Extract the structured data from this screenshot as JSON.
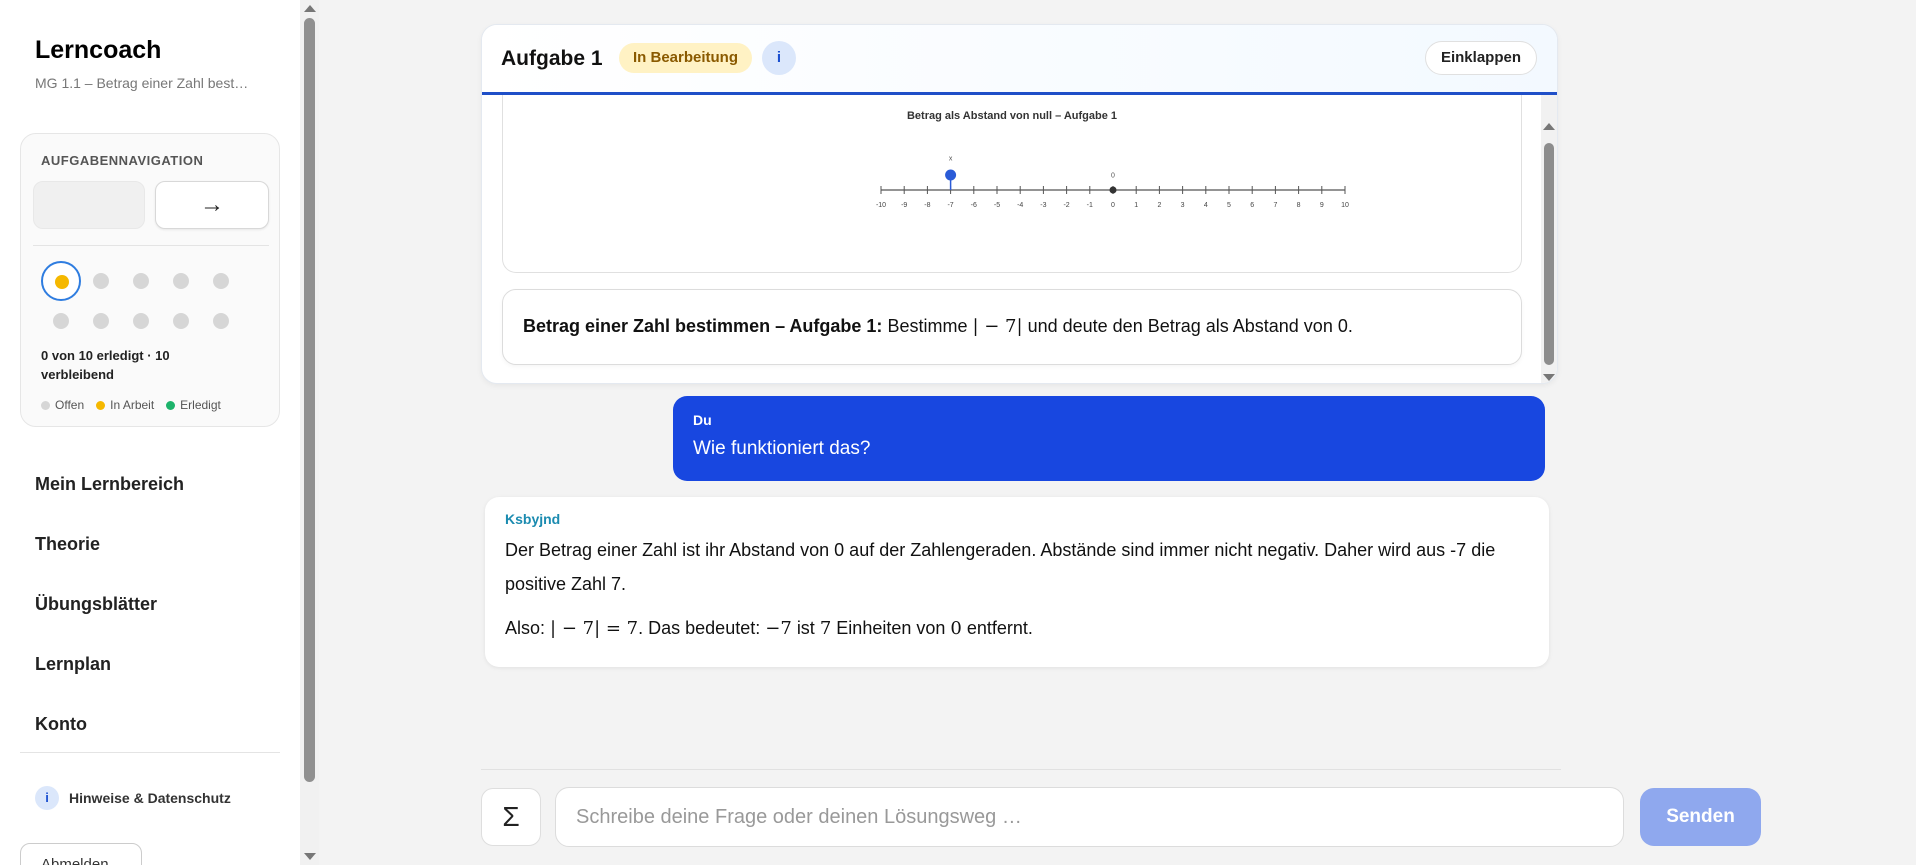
{
  "sidebar": {
    "brand": "Lerncoach",
    "subtitle": "MG 1.1 – Betrag einer Zahl best…",
    "nav_card": {
      "title": "AUFGABENNAVIGATION",
      "next_icon": "→",
      "progress_text": "0 von 10 erledigt · 10 verbleibend",
      "tasks": [
        {
          "status": "in-arbeit",
          "current": true
        },
        {
          "status": "offen"
        },
        {
          "status": "offen"
        },
        {
          "status": "offen"
        },
        {
          "status": "offen"
        },
        {
          "status": "offen"
        },
        {
          "status": "offen"
        },
        {
          "status": "offen"
        },
        {
          "status": "offen"
        },
        {
          "status": "offen"
        }
      ],
      "legend": [
        {
          "label": "Offen",
          "color": "#d6d6d6"
        },
        {
          "label": "In Arbeit",
          "color": "#f5b800"
        },
        {
          "label": "Erledigt",
          "color": "#1db36b"
        }
      ]
    },
    "menu": [
      "Mein Lernbereich",
      "Theorie",
      "Übungsblätter",
      "Lernplan",
      "Konto"
    ],
    "hint_icon": "i",
    "hint": "Hinweise & Datenschutz",
    "logout": "Abmelden"
  },
  "task": {
    "title": "Aufgabe 1",
    "badge": "In Bearbeitung",
    "info_icon": "i",
    "collapse": "Einklappen",
    "figure_title": "Betrag als Abstand von null – Aufgabe 1",
    "statement_bold": "Betrag einer Zahl bestimmen – Aufgabe 1:",
    "statement_pre": "Bestimme",
    "statement_math": "| − 7|",
    "statement_post": "und deute den Betrag als Abstand von 0."
  },
  "chart_data": {
    "type": "scatter",
    "title": "Betrag als Abstand von null – Aufgabe 1",
    "xlim": [
      -10,
      10
    ],
    "ticks": [
      -10,
      -9,
      -8,
      -7,
      -6,
      -5,
      -4,
      -3,
      -2,
      -1,
      0,
      1,
      2,
      3,
      4,
      5,
      6,
      7,
      8,
      9,
      10
    ],
    "points": [
      {
        "label": "x",
        "x": -7,
        "color": "#2a5bd7"
      },
      {
        "label": "0",
        "x": 0,
        "color": "#333333"
      }
    ]
  },
  "chat": {
    "user_name": "Du",
    "user_msg": "Wie funktioniert das?",
    "bot_name": "Ksbyjnd",
    "bot_p1": "Der Betrag einer Zahl ist ihr Abstand von 0 auf der Zahlengeraden. Abstände sind immer nicht negativ. Daher wird aus   -7 die positive Zahl 7.",
    "bot_p2_pre": "Also:",
    "bot_p2_math1": "| − 7| = 7",
    "bot_p2_mid1": ". Das bedeutet:",
    "bot_p2_math2": "−7",
    "bot_p2_mid2": "ist",
    "bot_p2_math3": "7",
    "bot_p2_mid3": "Einheiten von",
    "bot_p2_math4": "0",
    "bot_p2_post": "entfernt."
  },
  "composer": {
    "sigma": "Σ",
    "placeholder": "Schreibe deine Frage oder deinen Lösungsweg …",
    "send": "Senden"
  }
}
